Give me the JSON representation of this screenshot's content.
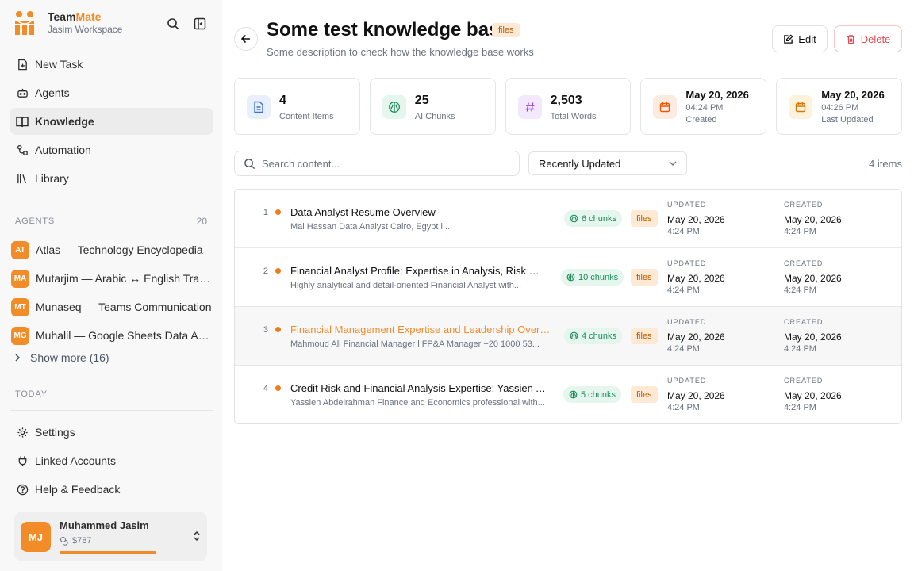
{
  "brand": {
    "name_a": "Team",
    "name_b": "Mate",
    "workspace": "Jasim Workspace"
  },
  "nav": [
    {
      "label": "New Task",
      "icon": "new-task-icon"
    },
    {
      "label": "Agents",
      "icon": "robot-icon"
    },
    {
      "label": "Knowledge",
      "icon": "book-icon",
      "active": true
    },
    {
      "label": "Automation",
      "icon": "workflow-icon"
    },
    {
      "label": "Library",
      "icon": "library-icon"
    }
  ],
  "agents_section": {
    "label": "AGENTS",
    "count": "20"
  },
  "agents": [
    {
      "initials": "AT",
      "name": "Atlas — Technology Encyclopedia"
    },
    {
      "initials": "MA",
      "name": "Mutarjim — Arabic ↔ English Translator"
    },
    {
      "initials": "MT",
      "name": "Munaseq — Teams Communication"
    },
    {
      "initials": "MG",
      "name": "Muhalil — Google Sheets Data Analyst"
    }
  ],
  "show_more": "Show more (16)",
  "today_label": "TODAY",
  "bottom_nav": [
    {
      "label": "Settings",
      "icon": "gear-icon"
    },
    {
      "label": "Linked Accounts",
      "icon": "plug-icon"
    },
    {
      "label": "Help & Feedback",
      "icon": "help-icon"
    }
  ],
  "user": {
    "initials": "MJ",
    "name": "Muhammed Jasim",
    "credits": "$787"
  },
  "page": {
    "title": "Some test knowledge base",
    "tag": "files",
    "description": "Some description to check how the knowledge base works",
    "edit_label": "Edit",
    "delete_label": "Delete"
  },
  "stats": {
    "items_value": "4",
    "items_label": "Content Items",
    "chunks_value": "25",
    "chunks_label": "AI Chunks",
    "words_value": "2,503",
    "words_label": "Total Words",
    "created_date": "May 20, 2026",
    "created_time": "04:24 PM",
    "created_label": "Created",
    "updated_date": "May 20, 2026",
    "updated_time": "04:26 PM",
    "updated_label": "Last Updated"
  },
  "toolbar": {
    "search_placeholder": "Search content...",
    "sort_value": "Recently Updated",
    "count": "4 items"
  },
  "columns": {
    "updated": "UPDATED",
    "created": "CREATED"
  },
  "rows": [
    {
      "num": "1",
      "title": "Data Analyst Resume Overview",
      "snippet": "Mai Hassan Data Analyst Cairo, Egypt l...",
      "chunks": "6 chunks",
      "tag": "files",
      "updated_date": "May 20, 2026",
      "updated_time": "4:24 PM",
      "created_date": "May 20, 2026",
      "created_time": "4:24 PM"
    },
    {
      "num": "2",
      "title": "Financial Analyst Profile: Expertise in Analysis, Risk Management",
      "snippet": "Highly analytical and detail-oriented Financial Analyst with...",
      "chunks": "10 chunks",
      "tag": "files",
      "updated_date": "May 20, 2026",
      "updated_time": "4:24 PM",
      "created_date": "May 20, 2026",
      "created_time": "4:24 PM"
    },
    {
      "num": "3",
      "title": "Financial Management Expertise and Leadership Overview",
      "snippet": "Mahmoud Ali Financial Manager l FP&A Manager +20 1000 53...",
      "chunks": "4 chunks",
      "tag": "files",
      "updated_date": "May 20, 2026",
      "updated_time": "4:24 PM",
      "created_date": "May 20, 2026",
      "created_time": "4:24 PM"
    },
    {
      "num": "4",
      "title": "Credit Risk and Financial Analysis Expertise: Yassien Abdelrahman",
      "snippet": "Yassien Abdelrahman Finance and Economics professional with...",
      "chunks": "5 chunks",
      "tag": "files",
      "updated_date": "May 20, 2026",
      "updated_time": "4:24 PM",
      "created_date": "May 20, 2026",
      "created_time": "4:24 PM"
    }
  ]
}
